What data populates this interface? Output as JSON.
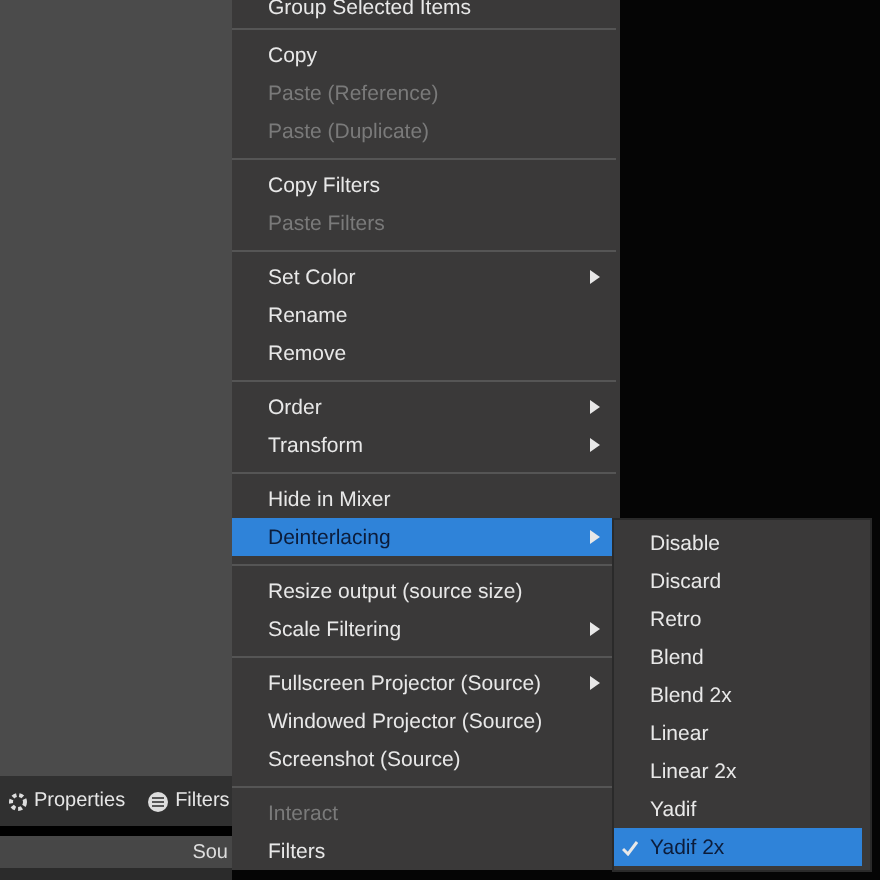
{
  "dock": {
    "buttons": [
      {
        "label": "Properties"
      },
      {
        "label": "Filters"
      }
    ],
    "column_header": "Sou"
  },
  "context_menu": {
    "items": [
      {
        "kind": "item",
        "label": "Group Selected Items",
        "disabled": false,
        "submenu": false,
        "selected": false
      },
      {
        "kind": "separator"
      },
      {
        "kind": "item",
        "label": "Copy",
        "disabled": false,
        "submenu": false,
        "selected": false
      },
      {
        "kind": "item",
        "label": "Paste (Reference)",
        "disabled": true,
        "submenu": false,
        "selected": false
      },
      {
        "kind": "item",
        "label": "Paste (Duplicate)",
        "disabled": true,
        "submenu": false,
        "selected": false
      },
      {
        "kind": "separator"
      },
      {
        "kind": "item",
        "label": "Copy Filters",
        "disabled": false,
        "submenu": false,
        "selected": false
      },
      {
        "kind": "item",
        "label": "Paste Filters",
        "disabled": true,
        "submenu": false,
        "selected": false
      },
      {
        "kind": "separator"
      },
      {
        "kind": "item",
        "label": "Set Color",
        "disabled": false,
        "submenu": true,
        "selected": false
      },
      {
        "kind": "item",
        "label": "Rename",
        "disabled": false,
        "submenu": false,
        "selected": false
      },
      {
        "kind": "item",
        "label": "Remove",
        "disabled": false,
        "submenu": false,
        "selected": false
      },
      {
        "kind": "separator"
      },
      {
        "kind": "item",
        "label": "Order",
        "disabled": false,
        "submenu": true,
        "selected": false
      },
      {
        "kind": "item",
        "label": "Transform",
        "disabled": false,
        "submenu": true,
        "selected": false
      },
      {
        "kind": "separator"
      },
      {
        "kind": "item",
        "label": "Hide in Mixer",
        "disabled": false,
        "submenu": false,
        "selected": false
      },
      {
        "kind": "item",
        "label": "Deinterlacing",
        "disabled": false,
        "submenu": true,
        "selected": true
      },
      {
        "kind": "separator"
      },
      {
        "kind": "item",
        "label": "Resize output (source size)",
        "disabled": false,
        "submenu": false,
        "selected": false
      },
      {
        "kind": "item",
        "label": "Scale Filtering",
        "disabled": false,
        "submenu": true,
        "selected": false
      },
      {
        "kind": "separator"
      },
      {
        "kind": "item",
        "label": "Fullscreen Projector (Source)",
        "disabled": false,
        "submenu": true,
        "selected": false
      },
      {
        "kind": "item",
        "label": "Windowed Projector (Source)",
        "disabled": false,
        "submenu": false,
        "selected": false
      },
      {
        "kind": "item",
        "label": "Screenshot (Source)",
        "disabled": false,
        "submenu": false,
        "selected": false
      },
      {
        "kind": "separator"
      },
      {
        "kind": "item",
        "label": "Interact",
        "disabled": true,
        "submenu": false,
        "selected": false
      },
      {
        "kind": "item",
        "label": "Filters",
        "disabled": false,
        "submenu": false,
        "selected": false
      }
    ]
  },
  "submenu": {
    "items": [
      {
        "label": "Disable",
        "checked": false,
        "selected": false
      },
      {
        "label": "Discard",
        "checked": false,
        "selected": false
      },
      {
        "label": "Retro",
        "checked": false,
        "selected": false
      },
      {
        "label": "Blend",
        "checked": false,
        "selected": false
      },
      {
        "label": "Blend 2x",
        "checked": false,
        "selected": false
      },
      {
        "label": "Linear",
        "checked": false,
        "selected": false
      },
      {
        "label": "Linear 2x",
        "checked": false,
        "selected": false
      },
      {
        "label": "Yadif",
        "checked": false,
        "selected": false
      },
      {
        "label": "Yadif 2x",
        "checked": true,
        "selected": true
      }
    ]
  }
}
